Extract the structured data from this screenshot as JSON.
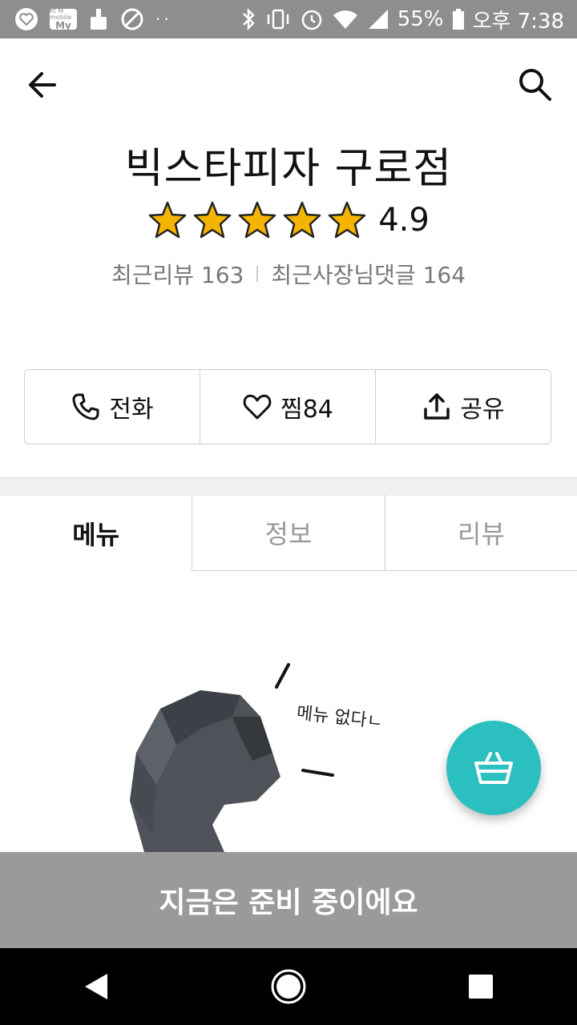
{
  "status_bar": {
    "carrier_badge_top": "kt M mobile",
    "carrier_badge": "My",
    "dots": "··",
    "battery": "55%",
    "time": "오후 7:38"
  },
  "store": {
    "name": "빅스타피자 구로점",
    "rating": "4.9",
    "rating_stars": 5,
    "recent_reviews_label": "최근리뷰 163",
    "recent_owner_replies_label": "최근사장님댓글 164"
  },
  "actions": {
    "call": "전화",
    "favorite": "찜84",
    "share": "공유"
  },
  "tabs": [
    "메뉴",
    "정보",
    "리뷰"
  ],
  "empty_menu": {
    "note": "메뉴 없다ㄴ"
  },
  "bottom_bar": {
    "label": "지금은 준비 중이에요"
  },
  "colors": {
    "fab": "#2cbfbf",
    "star": "#f5b400",
    "bottom_bar": "#9a9a9a"
  }
}
